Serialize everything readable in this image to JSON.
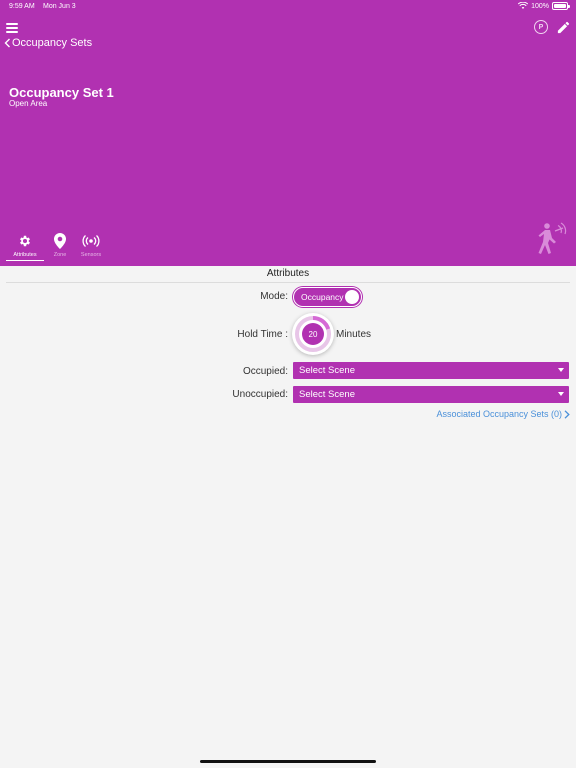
{
  "status_bar": {
    "time": "9:59 AM",
    "date": "Mon Jun 3",
    "battery": "100%"
  },
  "header": {
    "back_label": "Occupancy Sets",
    "title": "Occupancy Set 1",
    "subtitle": "Open Area",
    "status_icon_letter": "P",
    "accent_color": "#b131b1"
  },
  "nav_tabs": [
    {
      "label": "Attributes",
      "icon": "gear-icon",
      "active": true
    },
    {
      "label": "Zone",
      "icon": "map-pin-icon",
      "active": false
    },
    {
      "label": "Sensors",
      "icon": "sensor-signal-icon",
      "active": false
    }
  ],
  "attributes": {
    "section_title": "Attributes",
    "mode": {
      "label": "Mode:",
      "value": "Occupancy",
      "toggle_on": true
    },
    "hold_time": {
      "label": "Hold Time :",
      "value": "20",
      "unit": "Minutes"
    },
    "occupied": {
      "label": "Occupied:",
      "value": "Select Scene"
    },
    "unoccupied": {
      "label": "Unoccupied:",
      "value": "Select Scene"
    },
    "associated_link": "Associated Occupancy Sets (0)"
  },
  "link_color": "#4a90d9"
}
